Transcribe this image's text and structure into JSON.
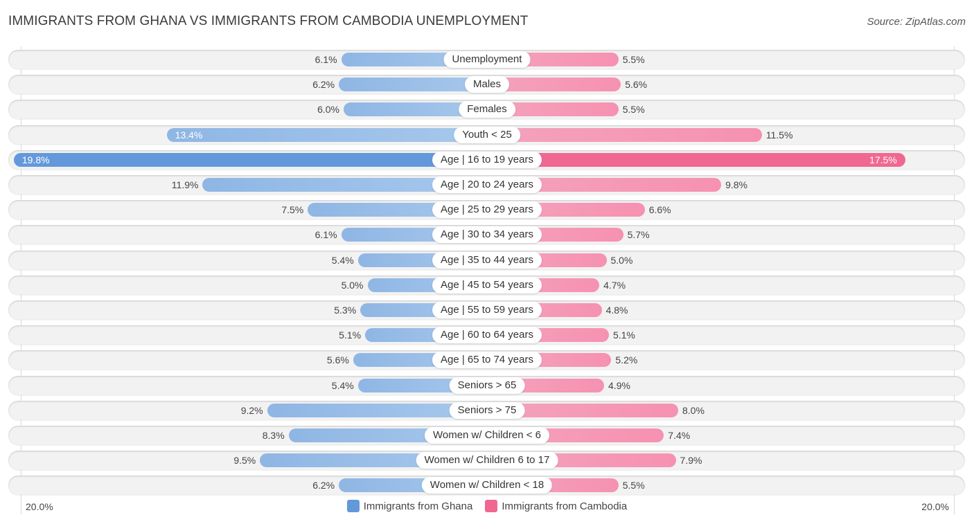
{
  "header": {
    "title": "IMMIGRANTS FROM GHANA VS IMMIGRANTS FROM CAMBODIA UNEMPLOYMENT",
    "source": "Source: ZipAtlas.com"
  },
  "colors": {
    "ghana": "#6399db",
    "ghana_light": "#a7c8ec",
    "cambodia": "#f06892",
    "cambodia_light": "#f691b1"
  },
  "chart_data": {
    "type": "bar",
    "orientation": "diverging-horizontal",
    "title": "IMMIGRANTS FROM GHANA VS IMMIGRANTS FROM CAMBODIA UNEMPLOYMENT",
    "categories": [
      "Unemployment",
      "Males",
      "Females",
      "Youth < 25",
      "Age | 16 to 19 years",
      "Age | 20 to 24 years",
      "Age | 25 to 29 years",
      "Age | 30 to 34 years",
      "Age | 35 to 44 years",
      "Age | 45 to 54 years",
      "Age | 55 to 59 years",
      "Age | 60 to 64 years",
      "Age | 65 to 74 years",
      "Seniors > 65",
      "Seniors > 75",
      "Women w/ Children < 6",
      "Women w/ Children 6 to 17",
      "Women w/ Children < 18"
    ],
    "series": [
      {
        "name": "Immigrants from Ghana",
        "side": "left",
        "values": [
          6.1,
          6.2,
          6.0,
          13.4,
          19.8,
          11.9,
          7.5,
          6.1,
          5.4,
          5.0,
          5.3,
          5.1,
          5.6,
          5.4,
          9.2,
          8.3,
          9.5,
          6.2
        ]
      },
      {
        "name": "Immigrants from Cambodia",
        "side": "right",
        "values": [
          5.5,
          5.6,
          5.5,
          11.5,
          17.5,
          9.8,
          6.6,
          5.7,
          5.0,
          4.7,
          4.8,
          5.1,
          5.2,
          4.9,
          8.0,
          7.4,
          7.9,
          5.5
        ]
      }
    ],
    "value_format": "%",
    "xlim": [
      -20,
      20
    ],
    "axis_labels": {
      "left": "20.0%",
      "right": "20.0%"
    },
    "legend_position": "bottom-center",
    "grid": false
  },
  "legend": [
    {
      "label": "Immigrants from Ghana"
    },
    {
      "label": "Immigrants from Cambodia"
    }
  ]
}
